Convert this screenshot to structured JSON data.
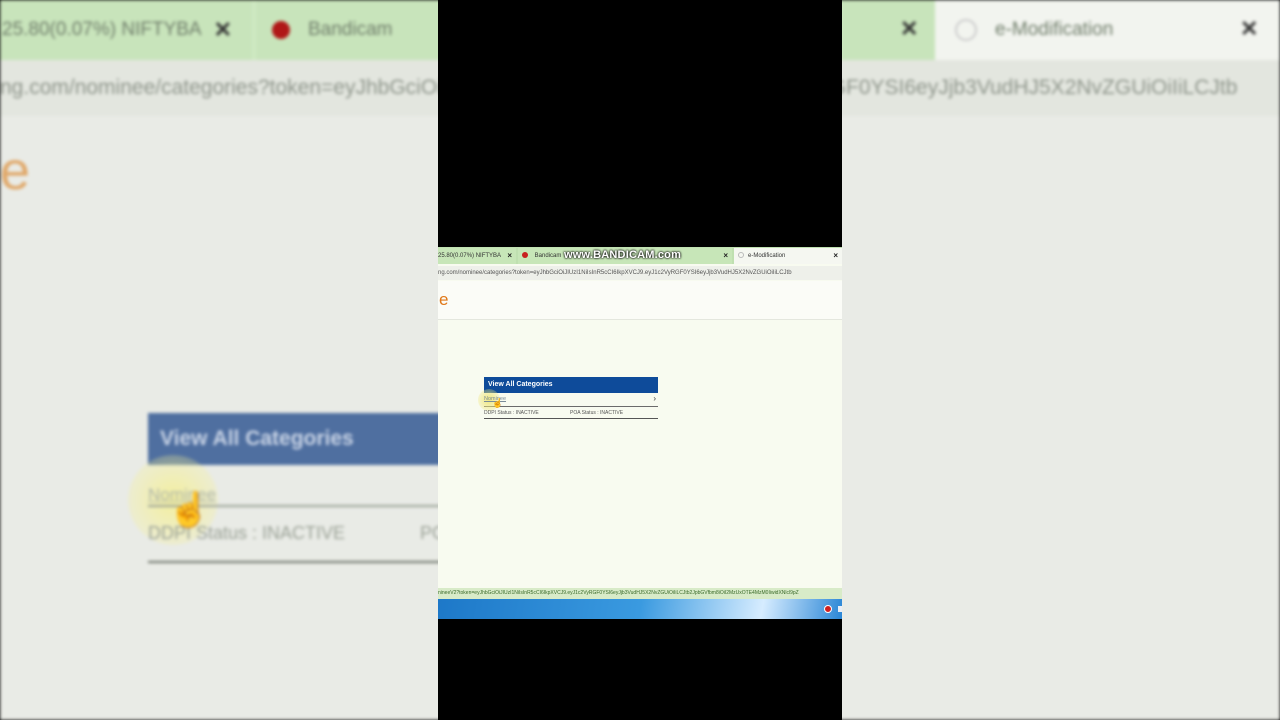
{
  "background": {
    "tab1_text": "25.80(0.07%) NIFTYBA",
    "tab2_text": "Bandicam",
    "tab3_text": "e-Modification",
    "url_text": "ng.com/nominee/categories?token=eyJhbGciOiJIUzI1NiIsInR5cCI6IkpXVCJ9.eyJ1c2VyRGF0YSI6eyJjb3VudHJ5X2NvZGUiOiIiLCJtb",
    "logo_fragment": "e",
    "card_title": "View All Categories",
    "nominee_link": "Nominee",
    "ddpi_status": "DDPI Status : INACTIVE",
    "poa_partial": "PO"
  },
  "browser": {
    "tabs": [
      {
        "label": "25.80(0.07%) NIFTYBA",
        "close": "×"
      },
      {
        "label": "Bandicam",
        "close": "×"
      },
      {
        "label": "e-Modification",
        "close": "×"
      }
    ],
    "watermark": "www.BANDICAM.com",
    "url": "ng.com/nominee/categories?token=eyJhbGciOiJIUzI1NiIsInR5cCI6IkpXVCJ9.eyJ1c2VyRGF0YSI6eyJjb3VudHJ5X2NvZGUiOiIiLCJtb"
  },
  "page": {
    "logo_fragment": "e",
    "card": {
      "title": "View All Categories",
      "item_label": "Nominee",
      "chevron": "›",
      "ddpi_status": "DDPI Status : INACTIVE",
      "poa_status": "POA Status : INACTIVE"
    }
  },
  "status_bar_url": "nineeV2?token=eyJhbGciOiJIUzI1NiIsInR5cCI6IkpXVCJ9.eyJ1c2VyRGF0YSI6eyJjb3VudHJ5X2NvZGUiOiIiLCJtb2JpbGVfbm8iOiI2MzUxOTE4MzM0IiwidXNlcl9pZ"
}
